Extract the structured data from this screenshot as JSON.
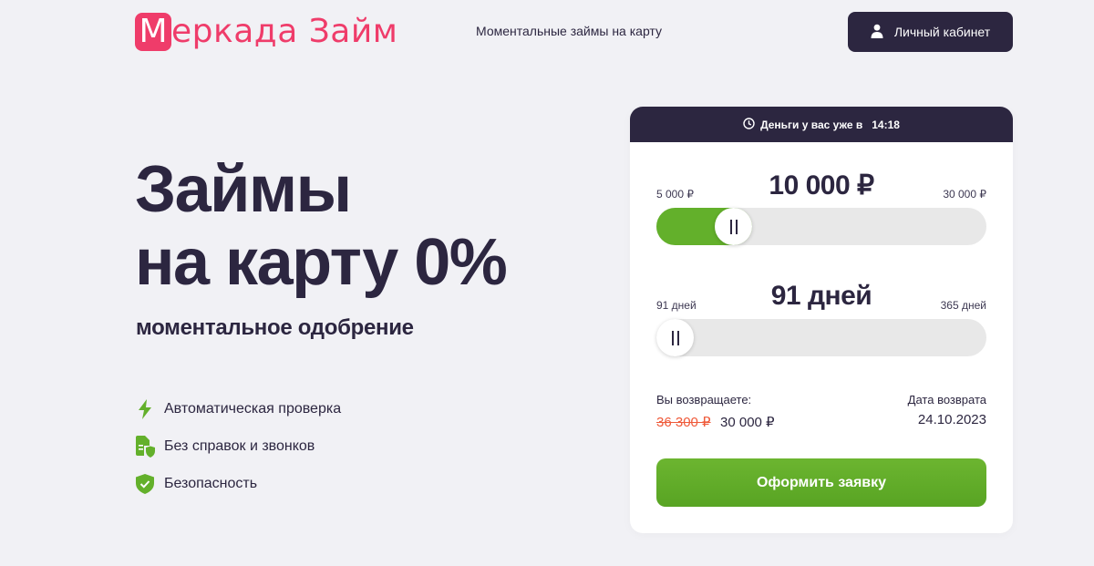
{
  "header": {
    "logo_letter": "М",
    "logo_text": "еркада Займ",
    "tagline": "Моментальные займы на карту",
    "cabinet_label": "Личный кабинет",
    "brand_color": "#ef3c6a",
    "dark_color": "#2c2640"
  },
  "hero": {
    "title_line1": "Займы",
    "title_line2": "на карту 0%",
    "subtitle": "моментальное одобрение",
    "features": [
      {
        "icon": "lightning-icon",
        "label": "Автоматическая проверка"
      },
      {
        "icon": "document-shield-icon",
        "label": "Без справок и звонков"
      },
      {
        "icon": "shield-check-icon",
        "label": "Безопасность"
      }
    ]
  },
  "calculator": {
    "header_text": "Деньги у вас уже в",
    "header_time": "14:18",
    "amount": {
      "min_label": "5 000 ₽",
      "max_label": "30 000 ₽",
      "value_label": "10 000 ₽",
      "min": 5000,
      "max": 30000,
      "value": 10000
    },
    "term": {
      "min_label": "91 дней",
      "max_label": "365 дней",
      "value_label": "91 дней",
      "min": 91,
      "max": 365,
      "value": 91
    },
    "repay_label": "Вы возвращаете:",
    "repay_old": "36 300 ₽",
    "repay_new": "30 000 ₽",
    "date_label": "Дата возврата",
    "date_value": "24.10.2023",
    "submit_label": "Оформить заявку",
    "accent_color": "#63b02b"
  }
}
